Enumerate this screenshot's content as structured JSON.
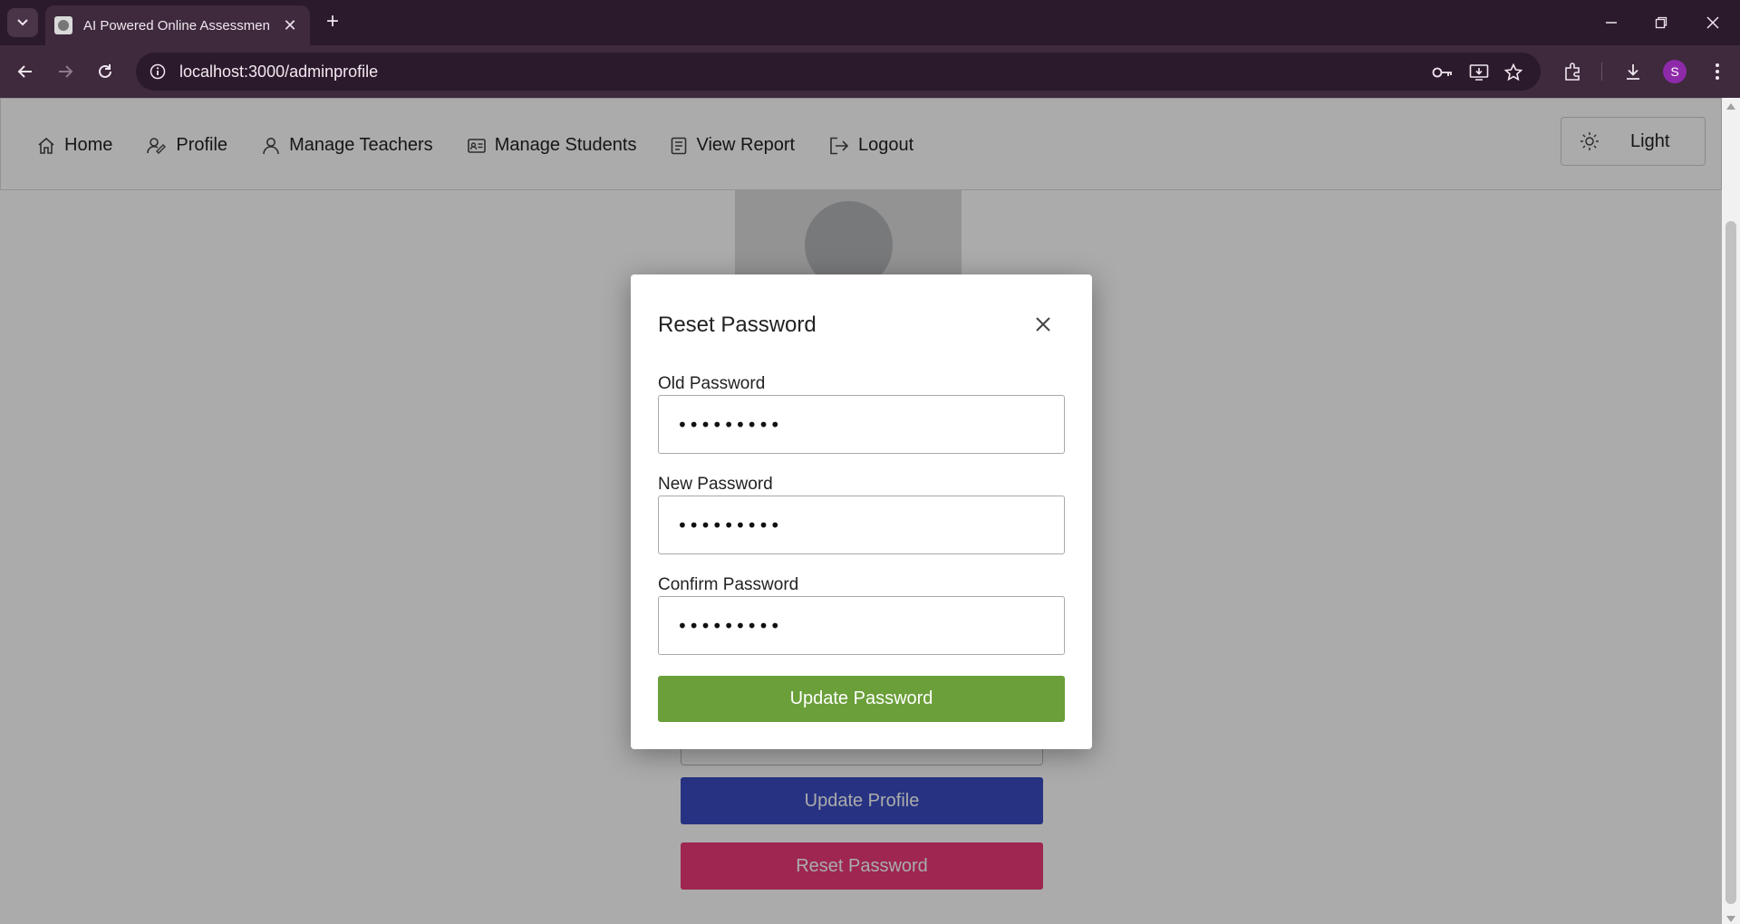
{
  "browser": {
    "tab_title": "AI Powered Online Assessment",
    "tab_close": "✕",
    "new_tab": "+",
    "url": "localhost:3000/adminprofile",
    "profile_initial": "S"
  },
  "navbar": {
    "items": [
      {
        "label": "Home",
        "icon": "home-icon"
      },
      {
        "label": "Profile",
        "icon": "profile-edit-icon"
      },
      {
        "label": "Manage Teachers",
        "icon": "person-icon"
      },
      {
        "label": "Manage Students",
        "icon": "id-card-icon"
      },
      {
        "label": "View Report",
        "icon": "report-icon"
      },
      {
        "label": "Logout",
        "icon": "logout-icon"
      }
    ],
    "theme_label": "Light"
  },
  "page_buttons": {
    "update_profile": "Update Profile",
    "reset_password": "Reset Password"
  },
  "modal": {
    "title": "Reset Password",
    "fields": [
      {
        "label": "Old Password",
        "value": "•••••••••"
      },
      {
        "label": "New Password",
        "value": "•••••••••"
      },
      {
        "label": "Confirm Password",
        "value": "•••••••••"
      }
    ],
    "submit_label": "Update Password"
  },
  "colors": {
    "update_password": "#6a9f39",
    "update_profile": "#3b4cc2",
    "reset_password": "#ec3a7a",
    "browser_frame": "#2b1a2b"
  }
}
